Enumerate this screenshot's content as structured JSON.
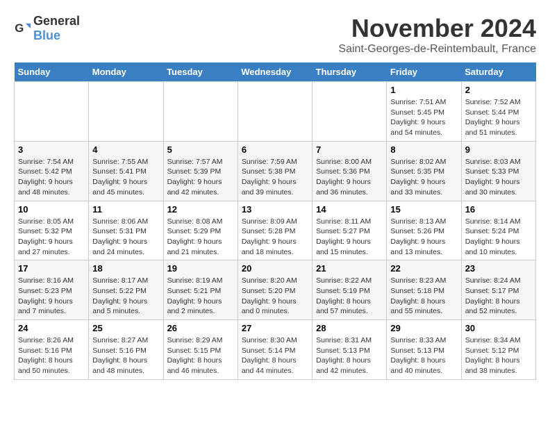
{
  "header": {
    "logo_general": "General",
    "logo_blue": "Blue",
    "title": "November 2024",
    "subtitle": "Saint-Georges-de-Reintembault, France"
  },
  "weekdays": [
    "Sunday",
    "Monday",
    "Tuesday",
    "Wednesday",
    "Thursday",
    "Friday",
    "Saturday"
  ],
  "weeks": [
    [
      {
        "day": "",
        "info": ""
      },
      {
        "day": "",
        "info": ""
      },
      {
        "day": "",
        "info": ""
      },
      {
        "day": "",
        "info": ""
      },
      {
        "day": "",
        "info": ""
      },
      {
        "day": "1",
        "info": "Sunrise: 7:51 AM\nSunset: 5:45 PM\nDaylight: 9 hours and 54 minutes."
      },
      {
        "day": "2",
        "info": "Sunrise: 7:52 AM\nSunset: 5:44 PM\nDaylight: 9 hours and 51 minutes."
      }
    ],
    [
      {
        "day": "3",
        "info": "Sunrise: 7:54 AM\nSunset: 5:42 PM\nDaylight: 9 hours and 48 minutes."
      },
      {
        "day": "4",
        "info": "Sunrise: 7:55 AM\nSunset: 5:41 PM\nDaylight: 9 hours and 45 minutes."
      },
      {
        "day": "5",
        "info": "Sunrise: 7:57 AM\nSunset: 5:39 PM\nDaylight: 9 hours and 42 minutes."
      },
      {
        "day": "6",
        "info": "Sunrise: 7:59 AM\nSunset: 5:38 PM\nDaylight: 9 hours and 39 minutes."
      },
      {
        "day": "7",
        "info": "Sunrise: 8:00 AM\nSunset: 5:36 PM\nDaylight: 9 hours and 36 minutes."
      },
      {
        "day": "8",
        "info": "Sunrise: 8:02 AM\nSunset: 5:35 PM\nDaylight: 9 hours and 33 minutes."
      },
      {
        "day": "9",
        "info": "Sunrise: 8:03 AM\nSunset: 5:33 PM\nDaylight: 9 hours and 30 minutes."
      }
    ],
    [
      {
        "day": "10",
        "info": "Sunrise: 8:05 AM\nSunset: 5:32 PM\nDaylight: 9 hours and 27 minutes."
      },
      {
        "day": "11",
        "info": "Sunrise: 8:06 AM\nSunset: 5:31 PM\nDaylight: 9 hours and 24 minutes."
      },
      {
        "day": "12",
        "info": "Sunrise: 8:08 AM\nSunset: 5:29 PM\nDaylight: 9 hours and 21 minutes."
      },
      {
        "day": "13",
        "info": "Sunrise: 8:09 AM\nSunset: 5:28 PM\nDaylight: 9 hours and 18 minutes."
      },
      {
        "day": "14",
        "info": "Sunrise: 8:11 AM\nSunset: 5:27 PM\nDaylight: 9 hours and 15 minutes."
      },
      {
        "day": "15",
        "info": "Sunrise: 8:13 AM\nSunset: 5:26 PM\nDaylight: 9 hours and 13 minutes."
      },
      {
        "day": "16",
        "info": "Sunrise: 8:14 AM\nSunset: 5:24 PM\nDaylight: 9 hours and 10 minutes."
      }
    ],
    [
      {
        "day": "17",
        "info": "Sunrise: 8:16 AM\nSunset: 5:23 PM\nDaylight: 9 hours and 7 minutes."
      },
      {
        "day": "18",
        "info": "Sunrise: 8:17 AM\nSunset: 5:22 PM\nDaylight: 9 hours and 5 minutes."
      },
      {
        "day": "19",
        "info": "Sunrise: 8:19 AM\nSunset: 5:21 PM\nDaylight: 9 hours and 2 minutes."
      },
      {
        "day": "20",
        "info": "Sunrise: 8:20 AM\nSunset: 5:20 PM\nDaylight: 9 hours and 0 minutes."
      },
      {
        "day": "21",
        "info": "Sunrise: 8:22 AM\nSunset: 5:19 PM\nDaylight: 8 hours and 57 minutes."
      },
      {
        "day": "22",
        "info": "Sunrise: 8:23 AM\nSunset: 5:18 PM\nDaylight: 8 hours and 55 minutes."
      },
      {
        "day": "23",
        "info": "Sunrise: 8:24 AM\nSunset: 5:17 PM\nDaylight: 8 hours and 52 minutes."
      }
    ],
    [
      {
        "day": "24",
        "info": "Sunrise: 8:26 AM\nSunset: 5:16 PM\nDaylight: 8 hours and 50 minutes."
      },
      {
        "day": "25",
        "info": "Sunrise: 8:27 AM\nSunset: 5:16 PM\nDaylight: 8 hours and 48 minutes."
      },
      {
        "day": "26",
        "info": "Sunrise: 8:29 AM\nSunset: 5:15 PM\nDaylight: 8 hours and 46 minutes."
      },
      {
        "day": "27",
        "info": "Sunrise: 8:30 AM\nSunset: 5:14 PM\nDaylight: 8 hours and 44 minutes."
      },
      {
        "day": "28",
        "info": "Sunrise: 8:31 AM\nSunset: 5:13 PM\nDaylight: 8 hours and 42 minutes."
      },
      {
        "day": "29",
        "info": "Sunrise: 8:33 AM\nSunset: 5:13 PM\nDaylight: 8 hours and 40 minutes."
      },
      {
        "day": "30",
        "info": "Sunrise: 8:34 AM\nSunset: 5:12 PM\nDaylight: 8 hours and 38 minutes."
      }
    ]
  ]
}
